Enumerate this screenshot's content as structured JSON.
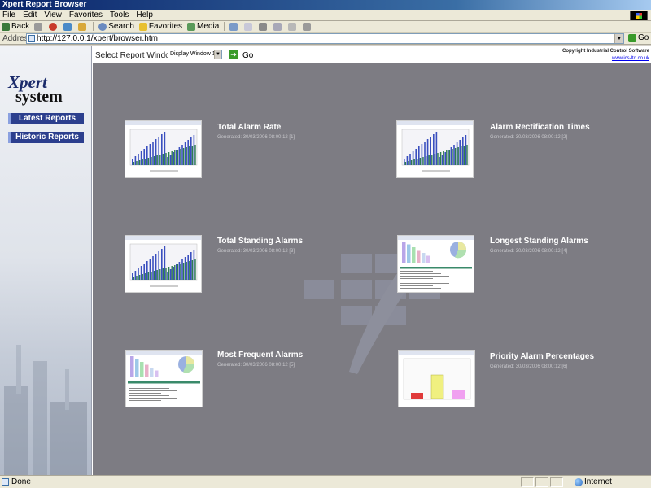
{
  "window": {
    "title": "Xpert Report Browser"
  },
  "menu": [
    "File",
    "Edit",
    "View",
    "Favorites",
    "Tools",
    "Help"
  ],
  "toolbar": {
    "back": "Back",
    "search": "Search",
    "favorites": "Favorites",
    "media": "Media"
  },
  "address": {
    "label": "Address",
    "url": "http://127.0.0.1/xpert/browser.htm",
    "go": "Go"
  },
  "sidebar": {
    "brand_top": "Xpert",
    "brand_bottom": "system",
    "buttons": [
      "Latest Reports",
      "Historic Reports"
    ]
  },
  "selector": {
    "label": "Select Report Window",
    "value": "Display Window 1",
    "go": "Go"
  },
  "copyright": {
    "text": "Copyright Industrial Control Software",
    "link": "www.ics-ltd.co.uk"
  },
  "reports": [
    {
      "title": "Total Alarm Rate",
      "generated": "Generated: 30/03/2006 08:00:12 [1]",
      "thumb": "bar"
    },
    {
      "title": "Alarm Rectification Times",
      "generated": "Generated: 30/03/2006 08:00:12 [2]",
      "thumb": "bar"
    },
    {
      "title": "Total Standing Alarms",
      "generated": "Generated: 30/03/2006 08:00:12 [3]",
      "thumb": "bar"
    },
    {
      "title": "Longest Standing Alarms",
      "generated": "Generated: 30/03/2006 08:00:12 [4]",
      "thumb": "table"
    },
    {
      "title": "Most Frequent Alarms",
      "generated": "Generated: 30/03/2006 08:00:12 [5]",
      "thumb": "table"
    },
    {
      "title": "Priority Alarm Percentages",
      "generated": "Generated: 30/03/2006 08:00:12 [6]",
      "thumb": "priority"
    }
  ],
  "status": {
    "text": "Done",
    "zone": "Internet"
  },
  "colors": {
    "panel": "#7d7c83",
    "nav": "#2c3f8e",
    "bar_blue": "#3a4fbf",
    "bar_green": "#2e7d4f"
  }
}
